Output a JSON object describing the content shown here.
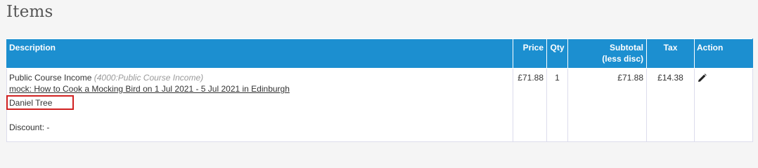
{
  "section": {
    "title": "Items"
  },
  "table": {
    "columns": {
      "description": "Description",
      "price": "Price",
      "qty": "Qty",
      "subtotal_line1": "Subtotal",
      "subtotal_line2": "(less disc)",
      "tax": "Tax",
      "action": "Action"
    },
    "rows": [
      {
        "item_name": "Public Course Income",
        "account": "(4000:Public Course Income)",
        "course_link": "mock: How to Cook a Mocking Bird on 1 Jul 2021 - 5 Jul 2021 in Edinburgh",
        "attendee": "Daniel Tree",
        "discount": "Discount: -",
        "price": "£71.88",
        "qty": "1",
        "subtotal": "£71.88",
        "tax": "£14.38",
        "action_icon": "pencil-icon"
      }
    ]
  },
  "colors": {
    "header_bg": "#1c8fd0",
    "highlight": "#d02020"
  }
}
